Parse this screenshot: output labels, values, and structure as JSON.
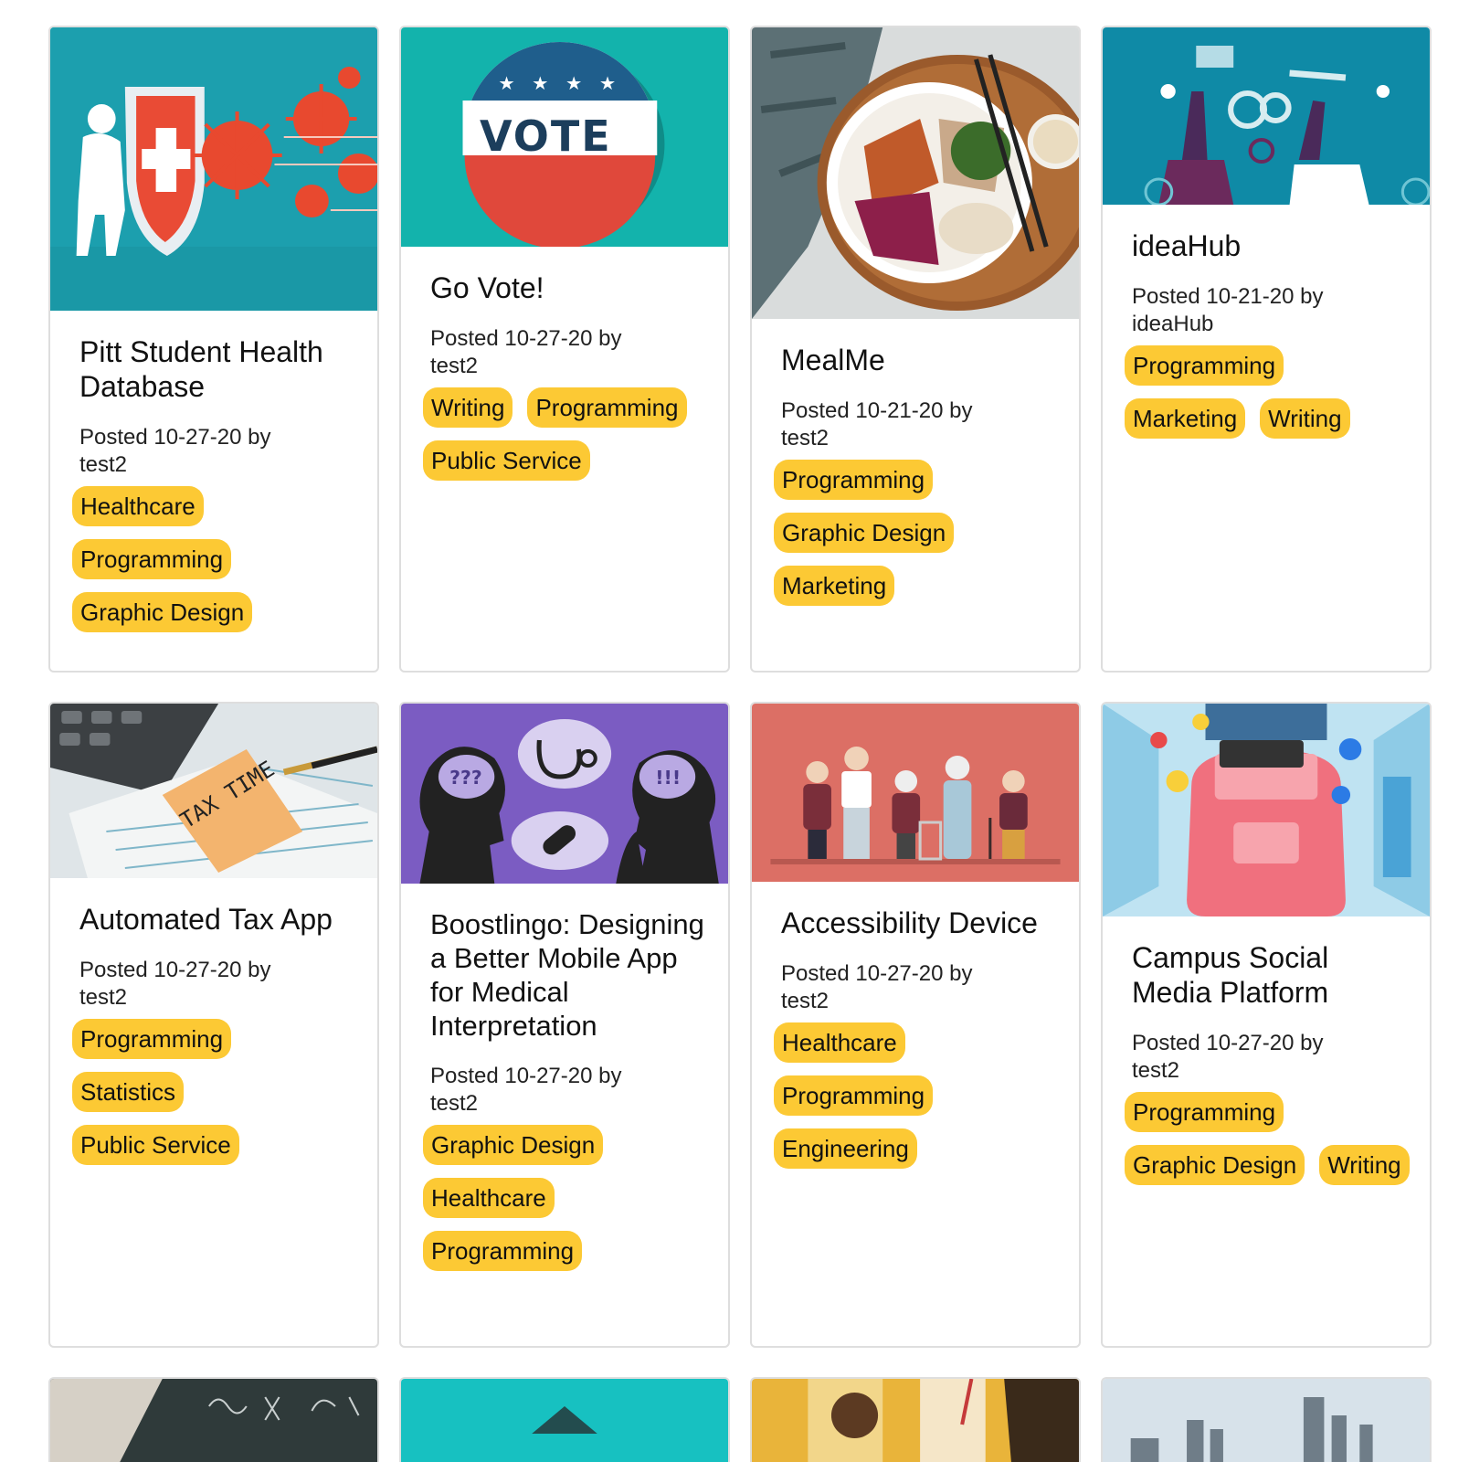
{
  "cards": [
    {
      "title": "Pitt Student Health Database",
      "posted": "Posted 10-27-20 by",
      "author": "test2",
      "image_icon": "virus-shield-illustration-icon",
      "tags": [
        "Healthcare",
        "Programming",
        "Graphic Design"
      ]
    },
    {
      "title": "Go Vote!",
      "posted": "Posted 10-27-20 by",
      "author": "test2",
      "image_icon": "vote-badge-icon",
      "image_text": "VOTE",
      "tags": [
        "Writing",
        "Programming",
        "Public Service"
      ]
    },
    {
      "title": "MealMe",
      "posted": "Posted 10-21-20 by",
      "author": "test2",
      "image_icon": "food-bowl-photo-icon",
      "tags": [
        "Programming",
        "Graphic Design",
        "Marketing"
      ]
    },
    {
      "title": "ideaHub",
      "posted": "Posted 10-21-20 by",
      "author": "ideaHub",
      "image_icon": "teamwork-gears-illustration-icon",
      "tags": [
        "Programming",
        "Marketing",
        "Writing"
      ]
    },
    {
      "title": "Automated Tax App",
      "posted": "Posted 10-27-20 by",
      "author": "test2",
      "image_icon": "tax-time-photo-icon",
      "image_text": "TAX TIME",
      "tags": [
        "Programming",
        "Statistics",
        "Public Service"
      ]
    },
    {
      "title": "Boostlingo: Designing a Better Mobile App for Medical Interpretation",
      "posted": "Posted 10-27-20 by",
      "author": "test2",
      "image_icon": "two-heads-speech-illustration-icon",
      "tags": [
        "Graphic Design",
        "Healthcare",
        "Programming"
      ]
    },
    {
      "title": "Accessibility Device",
      "posted": "Posted 10-27-20 by",
      "author": "test2",
      "image_icon": "elderly-people-illustration-icon",
      "tags": [
        "Healthcare",
        "Programming",
        "Engineering"
      ]
    },
    {
      "title": "Campus Social Media Platform",
      "posted": "Posted 10-27-20 by",
      "author": "test2",
      "image_icon": "backpack-social-icons-illustration-icon",
      "tags": [
        "Programming",
        "Graphic Design",
        "Writing"
      ]
    }
  ],
  "partial_cards": [
    {
      "image_icon": "chalkboard-photo-icon"
    },
    {
      "image_icon": "teal-graduation-cap-icon"
    },
    {
      "image_icon": "drinks-photo-icon"
    },
    {
      "image_icon": "pittsburgh-skyline-photo-icon"
    }
  ],
  "colors": {
    "tag_background": "#fcc934",
    "card_border": "#dedede"
  }
}
